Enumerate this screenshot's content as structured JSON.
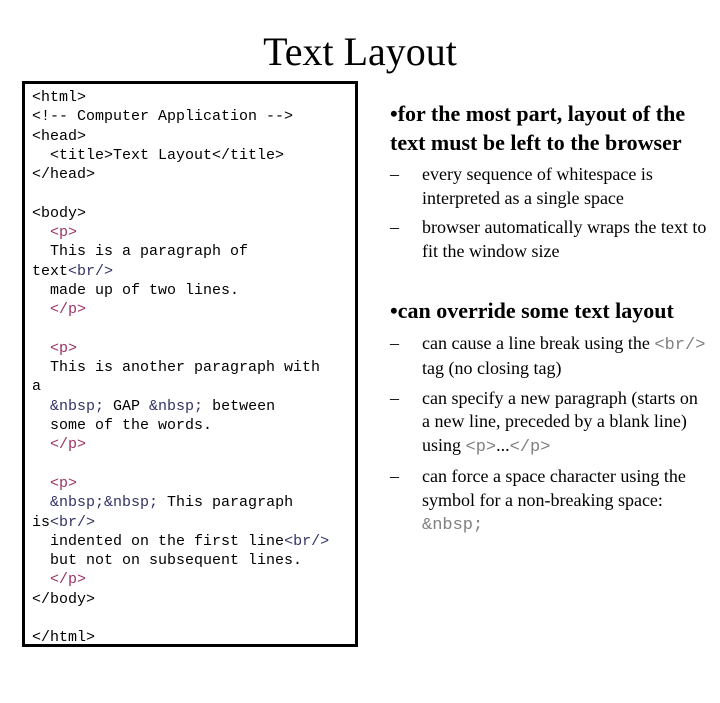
{
  "slide": {
    "title": "Text Layout"
  },
  "code": {
    "lines": [
      {
        "indent": "",
        "parts": [
          {
            "t": "<html>",
            "c": "plain"
          }
        ]
      },
      {
        "indent": "",
        "parts": [
          {
            "t": "<!-- Computer Application -->",
            "c": "plain"
          }
        ]
      },
      {
        "indent": "",
        "parts": [
          {
            "t": "<head>",
            "c": "plain"
          }
        ]
      },
      {
        "indent": "  ",
        "parts": [
          {
            "t": "<title>Text Layout</title>",
            "c": "plain"
          }
        ]
      },
      {
        "indent": "",
        "parts": [
          {
            "t": "</head>",
            "c": "plain"
          }
        ]
      },
      {
        "indent": "",
        "parts": []
      },
      {
        "indent": "",
        "parts": [
          {
            "t": "<body>",
            "c": "plain"
          }
        ]
      },
      {
        "indent": "  ",
        "parts": [
          {
            "t": "<p>",
            "c": "tag"
          }
        ]
      },
      {
        "indent": "  ",
        "parts": [
          {
            "t": "This is a paragraph of",
            "c": "plain"
          }
        ]
      },
      {
        "indent": "",
        "parts": [
          {
            "t": "text",
            "c": "plain"
          },
          {
            "t": "<br/>",
            "c": "ent"
          }
        ]
      },
      {
        "indent": "  ",
        "parts": [
          {
            "t": "made up of two lines.",
            "c": "plain"
          }
        ]
      },
      {
        "indent": "  ",
        "parts": [
          {
            "t": "</p>",
            "c": "tag"
          }
        ]
      },
      {
        "indent": "",
        "parts": []
      },
      {
        "indent": "  ",
        "parts": [
          {
            "t": "<p>",
            "c": "tag"
          }
        ]
      },
      {
        "indent": "  ",
        "parts": [
          {
            "t": "This is another paragraph with",
            "c": "plain"
          }
        ]
      },
      {
        "indent": "",
        "parts": [
          {
            "t": "a",
            "c": "plain"
          }
        ]
      },
      {
        "indent": "  ",
        "parts": [
          {
            "t": "&nbsp;",
            "c": "ent"
          },
          {
            "t": " GAP ",
            "c": "plain"
          },
          {
            "t": "&nbsp;",
            "c": "ent"
          },
          {
            "t": " between",
            "c": "plain"
          }
        ]
      },
      {
        "indent": "  ",
        "parts": [
          {
            "t": "some of the words.",
            "c": "plain"
          }
        ]
      },
      {
        "indent": "  ",
        "parts": [
          {
            "t": "</p>",
            "c": "tag"
          }
        ]
      },
      {
        "indent": "",
        "parts": []
      },
      {
        "indent": "  ",
        "parts": [
          {
            "t": "<p>",
            "c": "tag"
          }
        ]
      },
      {
        "indent": "  ",
        "parts": [
          {
            "t": "&nbsp;&nbsp;",
            "c": "ent"
          },
          {
            "t": " This paragraph",
            "c": "plain"
          }
        ]
      },
      {
        "indent": "",
        "parts": [
          {
            "t": "is",
            "c": "plain"
          },
          {
            "t": "<br/>",
            "c": "ent"
          }
        ]
      },
      {
        "indent": "  ",
        "parts": [
          {
            "t": "indented on the first line",
            "c": "plain"
          },
          {
            "t": "<br/>",
            "c": "ent"
          }
        ]
      },
      {
        "indent": "  ",
        "parts": [
          {
            "t": "but not on subsequent lines.",
            "c": "plain"
          }
        ]
      },
      {
        "indent": "  ",
        "parts": [
          {
            "t": "</p>",
            "c": "tag"
          }
        ]
      },
      {
        "indent": "",
        "parts": [
          {
            "t": "</body>",
            "c": "plain"
          }
        ]
      },
      {
        "indent": "",
        "parts": []
      },
      {
        "indent": "",
        "parts": [
          {
            "t": "</html>",
            "c": "plain"
          }
        ]
      }
    ]
  },
  "bullets": [
    {
      "text": "•for the most part, layout of the text must be left to the browser",
      "subs": [
        {
          "parts": [
            {
              "t": "every sequence of whitespace is interpreted as a single space",
              "m": false
            }
          ]
        },
        {
          "parts": [
            {
              "t": "browser automatically wraps the text to fit the window size",
              "m": false
            }
          ]
        }
      ]
    },
    {
      "text": "•can override some text layout",
      "subs": [
        {
          "parts": [
            {
              "t": "can cause a line break using the ",
              "m": false
            },
            {
              "t": "<br/>",
              "m": true
            },
            {
              "t": "  tag (no closing tag)",
              "m": false
            }
          ]
        },
        {
          "parts": [
            {
              "t": "can specify a new paragraph (starts on a new line, preceded by a blank line) using ",
              "m": false
            },
            {
              "t": "<p>",
              "m": true
            },
            {
              "t": "...",
              "m": false
            },
            {
              "t": "</p>",
              "m": true
            }
          ]
        },
        {
          "parts": [
            {
              "t": "can force a space character using the symbol for a non-breaking space:  ",
              "m": false
            },
            {
              "t": "&nbsp;",
              "m": true
            }
          ]
        }
      ]
    }
  ],
  "dash": "–"
}
